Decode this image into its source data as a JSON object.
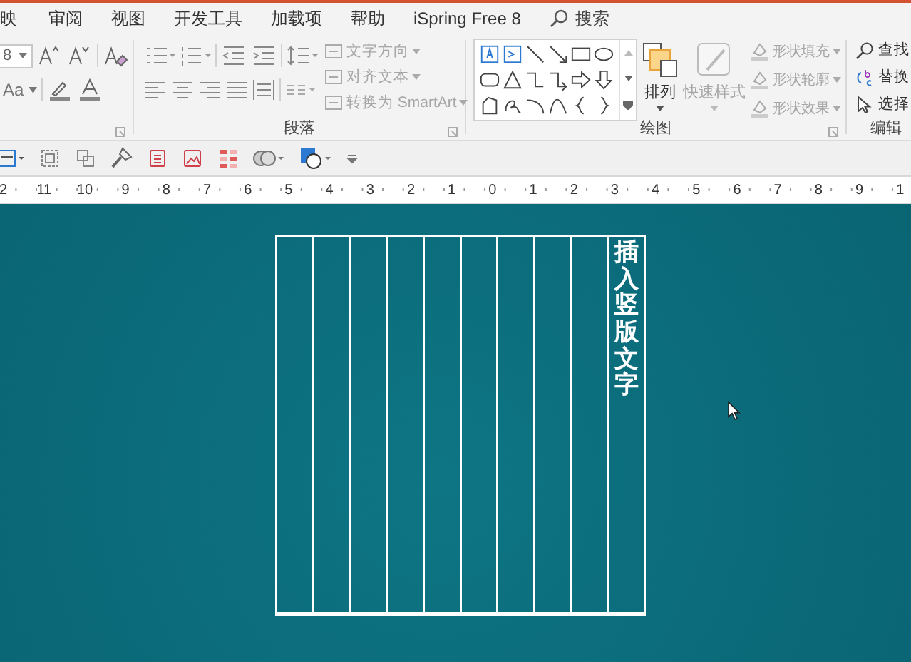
{
  "menu_tabs": [
    {
      "label": "映",
      "selected": false
    },
    {
      "label": "审阅",
      "selected": false
    },
    {
      "label": "视图",
      "selected": false
    },
    {
      "label": "开发工具",
      "selected": false
    },
    {
      "label": "加载项",
      "selected": false
    },
    {
      "label": "帮助",
      "selected": false
    },
    {
      "label": "iSpring Free 8",
      "selected": false
    }
  ],
  "search": {
    "placeholder": "搜索"
  },
  "font_group": {
    "font_size": "8",
    "case_button": "Aa"
  },
  "paragraph_group": {
    "label": "段落",
    "text_buttons": [
      {
        "label": "文字方向",
        "disabled": true
      },
      {
        "label": "对齐文本",
        "disabled": true
      },
      {
        "label": "转换为 SmartArt",
        "disabled": true
      }
    ]
  },
  "drawing_group": {
    "label": "绘图",
    "arrange": {
      "label": "排列",
      "disabled": false
    },
    "quick_styles": {
      "label": "快速样式",
      "disabled": true
    },
    "shape_buttons": [
      {
        "label": "形状填充",
        "disabled": true
      },
      {
        "label": "形状轮廓",
        "disabled": true
      },
      {
        "label": "形状效果",
        "disabled": true
      }
    ]
  },
  "editing_group": {
    "label": "编辑",
    "buttons": [
      {
        "label": "查找",
        "kind": "find"
      },
      {
        "label": "替换",
        "kind": "replace"
      },
      {
        "label": "选择",
        "kind": "select"
      }
    ]
  },
  "ruler": {
    "labels": [
      "2",
      "11",
      "10",
      "9",
      "8",
      "7",
      "6",
      "5",
      "4",
      "3",
      "2",
      "1",
      "0",
      "1",
      "2",
      "3",
      "4",
      "5",
      "6",
      "7",
      "8",
      "9",
      "1"
    ]
  },
  "slide": {
    "table": {
      "columns": [
        {
          "kind": "empty"
        },
        {
          "kind": "empty"
        },
        {
          "kind": "empty"
        },
        {
          "kind": "empty"
        },
        {
          "kind": "empty"
        },
        {
          "kind": "empty"
        },
        {
          "kind": "empty"
        },
        {
          "kind": "empty"
        },
        {
          "kind": "empty"
        },
        {
          "kind": "text",
          "text": "插入竖版文字"
        }
      ]
    }
  }
}
